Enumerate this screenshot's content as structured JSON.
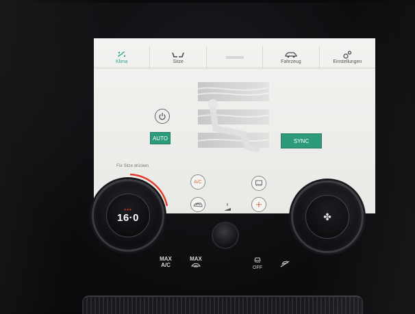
{
  "nav": {
    "tabs": [
      {
        "label": "Klima",
        "icon": "climate-icon",
        "active": true
      },
      {
        "label": "Sitze",
        "icon": "seat-icon",
        "active": false
      },
      {
        "label": "",
        "icon": "handle-bar",
        "active": false
      },
      {
        "label": "Fahrzeug",
        "icon": "car-icon",
        "active": false
      },
      {
        "label": "Einstellungen",
        "icon": "settings-icon",
        "active": false
      }
    ]
  },
  "climate": {
    "auto_label": "AUTO",
    "sync_label": "SYNC",
    "hint": "Für Sitze drücken",
    "ac_label": "A/C",
    "fan_level": "1",
    "accent_color": "#2d9a7a"
  },
  "knobs": {
    "left_temp": "16·0",
    "left_dots": "•••"
  },
  "hardware": {
    "max_ac_line1": "MAX",
    "max_ac_line2": "A/C",
    "max_defrost_line1": "MAX",
    "tc_off_label": "OFF"
  }
}
